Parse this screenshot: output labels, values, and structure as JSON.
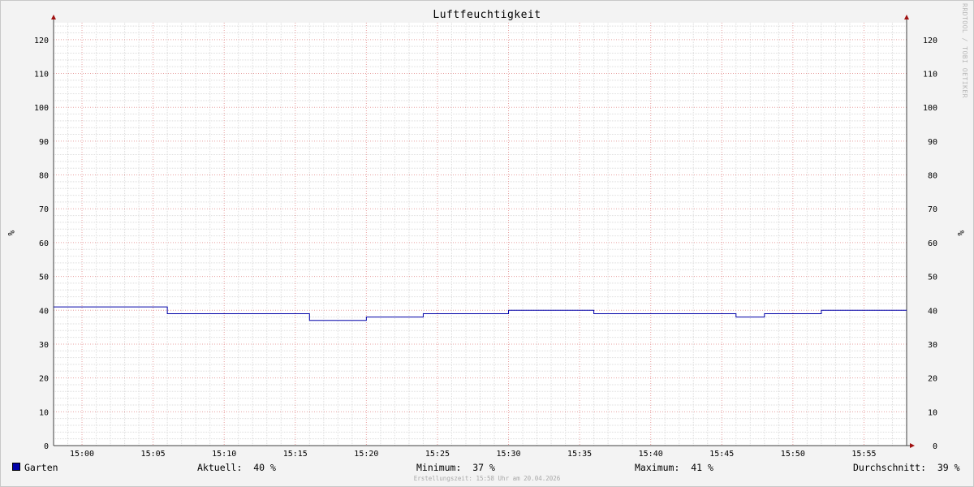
{
  "chart_data": {
    "type": "line",
    "title": "Luftfeuchtigkeit",
    "ylabel": "%",
    "ylim": [
      0,
      125
    ],
    "yticks": [
      0,
      10,
      20,
      30,
      40,
      50,
      60,
      70,
      80,
      90,
      100,
      110,
      120
    ],
    "xlim": [
      "14:58",
      "15:58"
    ],
    "xticks": [
      "15:00",
      "15:05",
      "15:10",
      "15:15",
      "15:20",
      "15:25",
      "15:30",
      "15:35",
      "15:40",
      "15:45",
      "15:50",
      "15:55"
    ],
    "grid": true,
    "series": [
      {
        "name": "Garten",
        "color": "#0000a8",
        "x": [
          "14:58",
          "15:06",
          "15:16",
          "15:20",
          "15:24",
          "15:26",
          "15:30",
          "15:36",
          "15:46",
          "15:48",
          "15:50",
          "15:52",
          "15:58"
        ],
        "y": [
          41,
          39,
          37,
          38,
          39,
          39,
          40,
          39,
          38,
          39,
          39,
          40,
          40
        ]
      }
    ],
    "stats": {
      "current_label": "Aktuell:",
      "current": "40 %",
      "min_label": "Minimum:",
      "min": "37 %",
      "max_label": "Maximum:",
      "max": "41 %",
      "avg_label": "Durchschnitt:",
      "avg": "39 %"
    }
  },
  "watermark": "RRDTOOL / TOBI OETIKER",
  "footer": "Erstellungszeit: 15:58 Uhr am 20.04.2026"
}
